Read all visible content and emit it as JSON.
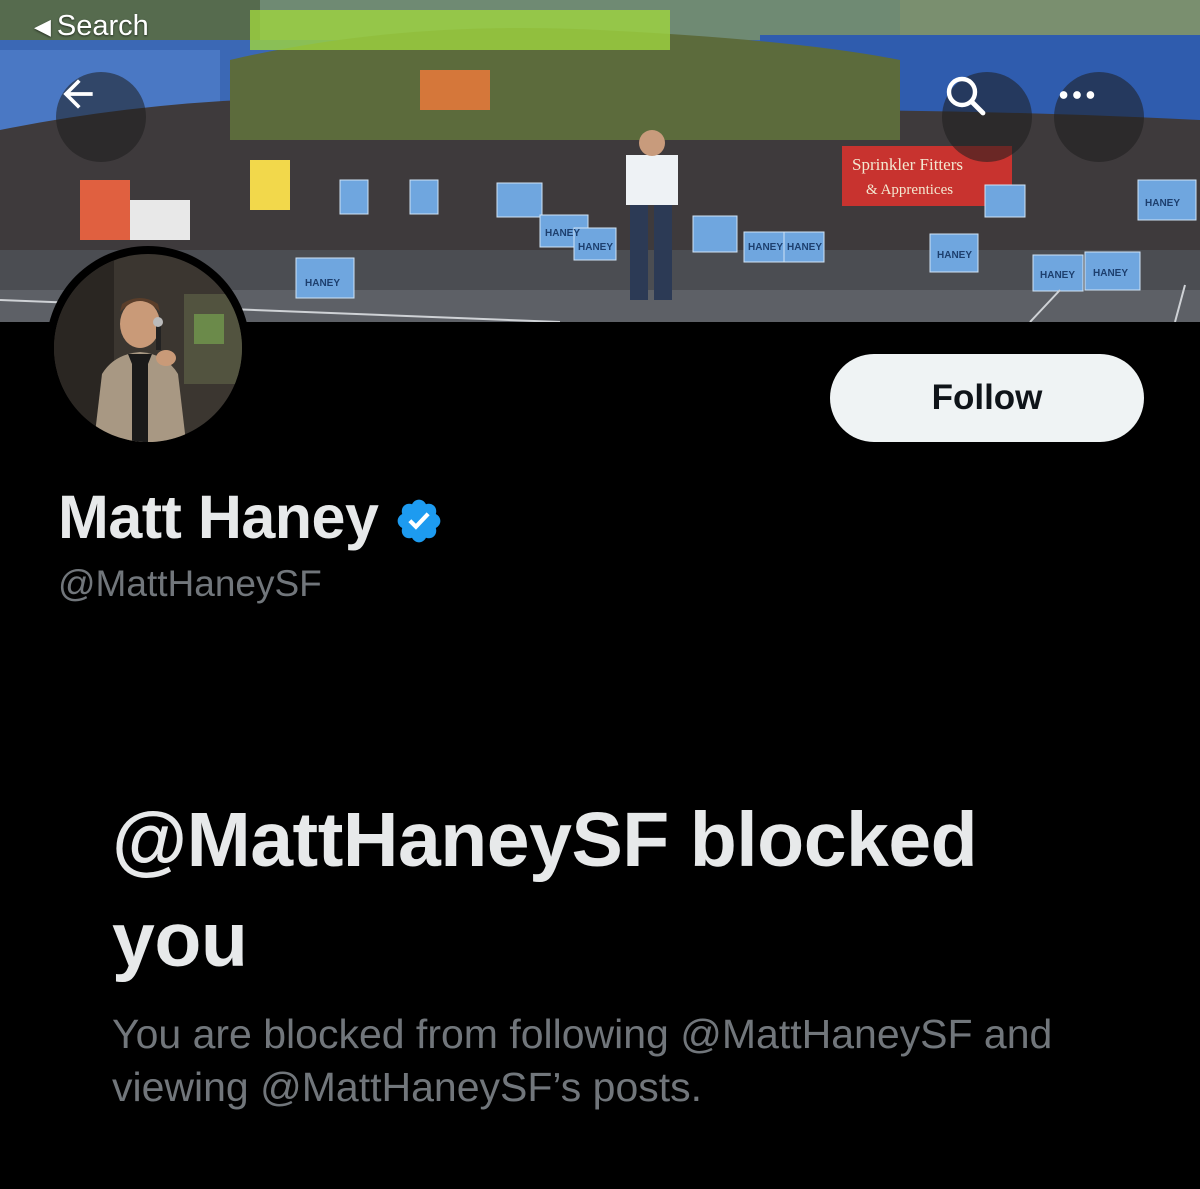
{
  "status_bar": {
    "back_label": "Search"
  },
  "profile": {
    "display_name": "Matt Haney",
    "handle": "@MattHaneySF",
    "follow_label": "Follow"
  },
  "banner_signs": {
    "sign_text": "HANEY",
    "banner_line1": "Sprinkler Fitters",
    "banner_line2": "& Apprentices"
  },
  "blocked": {
    "title": "@MattHaneySF blocked you",
    "description": "You are blocked from following @MattHaneySF and viewing @MattHaneySF’s posts."
  },
  "colors": {
    "background": "#000000",
    "primary_text": "#e7e9ea",
    "secondary_text": "#71767b",
    "follow_button_bg": "#eff3f4",
    "verified_badge": "#1d9bf0"
  },
  "icons": [
    "back-arrow-icon",
    "search-icon",
    "more-icon",
    "verified-badge-icon",
    "back-triangle-icon"
  ]
}
